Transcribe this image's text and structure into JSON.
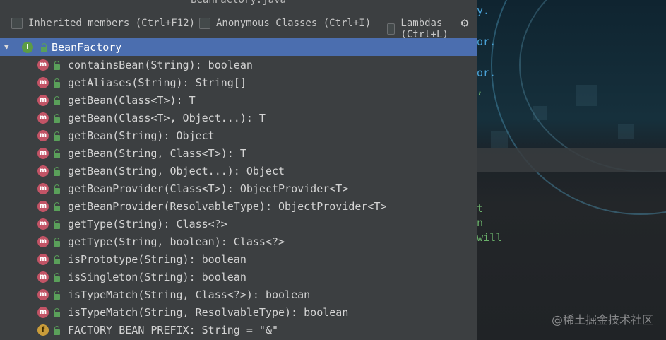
{
  "popup": {
    "title": "BeanFactory.java",
    "options": {
      "inherited": "Inherited members (Ctrl+F12)",
      "anonymous": "Anonymous Classes (Ctrl+I)",
      "lambdas": "Lambdas (Ctrl+L)"
    },
    "root": {
      "label": "BeanFactory",
      "icon": "interface-icon"
    },
    "members": [
      {
        "label": "containsBean(String): boolean",
        "icon": "method-icon"
      },
      {
        "label": "getAliases(String): String[]",
        "icon": "method-icon"
      },
      {
        "label": "getBean(Class<T>): T",
        "icon": "method-icon"
      },
      {
        "label": "getBean(Class<T>, Object...): T",
        "icon": "method-icon"
      },
      {
        "label": "getBean(String): Object",
        "icon": "method-icon"
      },
      {
        "label": "getBean(String, Class<T>): T",
        "icon": "method-icon"
      },
      {
        "label": "getBean(String, Object...): Object",
        "icon": "method-icon"
      },
      {
        "label": "getBeanProvider(Class<T>): ObjectProvider<T>",
        "icon": "method-icon"
      },
      {
        "label": "getBeanProvider(ResolvableType): ObjectProvider<T>",
        "icon": "method-icon"
      },
      {
        "label": "getType(String): Class<?>",
        "icon": "method-icon"
      },
      {
        "label": "getType(String, boolean): Class<?>",
        "icon": "method-icon"
      },
      {
        "label": "isPrototype(String): boolean",
        "icon": "method-icon"
      },
      {
        "label": "isSingleton(String): boolean",
        "icon": "method-icon"
      },
      {
        "label": "isTypeMatch(String, Class<?>): boolean",
        "icon": "method-icon"
      },
      {
        "label": "isTypeMatch(String, ResolvableType): boolean",
        "icon": "method-icon"
      },
      {
        "label": "FACTORY_BEAN_PREFIX: String = \"&\"",
        "icon": "field-icon"
      }
    ]
  },
  "editor_fragments": [
    "y.",
    "or.",
    "or.",
    ",",
    "t",
    "n",
    "will"
  ],
  "watermark": "@稀土掘金技术社区",
  "colors": {
    "selection": "#4b6eaf",
    "method_icon": "#c25466",
    "interface_icon": "#5c9c45",
    "field_icon": "#c99c3a",
    "lock": "#5aa05a"
  }
}
